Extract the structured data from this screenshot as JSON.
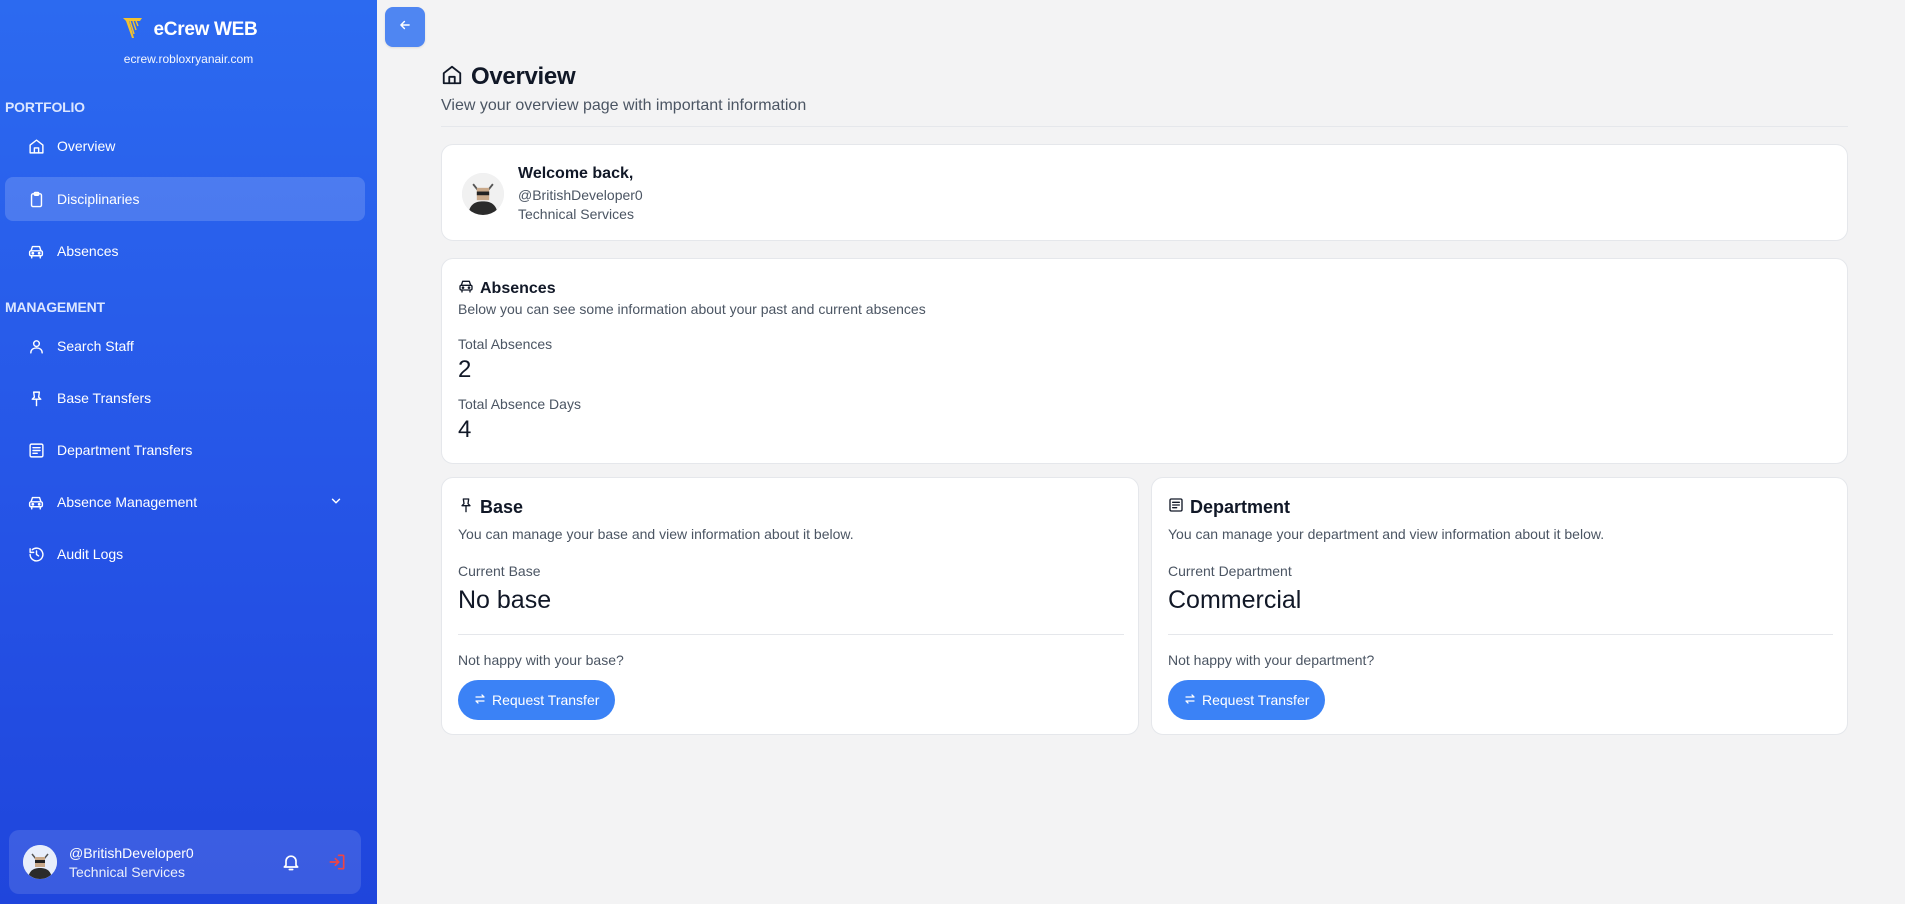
{
  "sidebar": {
    "brand_title": "eCrew WEB",
    "brand_url": "ecrew.robloxryanair.com",
    "section_portfolio": "PORTFOLIO",
    "section_management": "MANAGEMENT",
    "items": {
      "overview": "Overview",
      "disciplinaries": "Disciplinaries",
      "absences": "Absences",
      "search_staff": "Search Staff",
      "base_transfers": "Base Transfers",
      "department_transfers": "Department Transfers",
      "absence_management": "Absence Management",
      "audit_logs": "Audit Logs"
    },
    "active_item": "Disciplinaries",
    "user": {
      "username": "@BritishDeveloper0",
      "role": "Technical Services"
    }
  },
  "header": {
    "title": "Overview",
    "subtitle": "View your overview page with important information"
  },
  "welcome": {
    "greeting": "Welcome back,",
    "username": "@BritishDeveloper0",
    "department": "Technical Services"
  },
  "absences": {
    "title": "Absences",
    "description": "Below you can see some information about your past and current absences",
    "total_label": "Total Absences",
    "total_value": "2",
    "days_label": "Total Absence Days",
    "days_value": "4"
  },
  "base": {
    "title": "Base",
    "description": "You can manage your base and view information about it below.",
    "current_label": "Current Base",
    "current_value": "No base",
    "prompt": "Not happy with your base?",
    "button_label": "Request Transfer"
  },
  "department": {
    "title": "Department",
    "description": "You can manage your department and view information about it below.",
    "current_label": "Current Department",
    "current_value": "Commercial",
    "prompt": "Not happy with your department?",
    "button_label": "Request Transfer"
  },
  "colors": {
    "sidebar_top": "#2c6af0",
    "sidebar_bottom": "#1f45dc",
    "accent": "#3b82f6",
    "logout_red": "#ef4444",
    "logo_gold": "#f2c230"
  },
  "icons": [
    "harp-logo-icon",
    "home-icon",
    "clipboard-icon",
    "car-icon",
    "user-icon",
    "pin-icon",
    "newspaper-icon",
    "chevron-down-icon",
    "history-icon",
    "bell-icon",
    "logout-icon",
    "arrow-left-icon",
    "swap-icon"
  ]
}
